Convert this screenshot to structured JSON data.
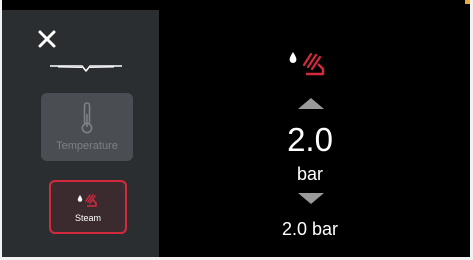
{
  "sidebar": {
    "close_icon": "close-icon",
    "modes": [
      {
        "label": "Temperature",
        "icon": "thermometer-icon",
        "state": "disabled"
      },
      {
        "label": "Steam",
        "icon": "steam-icon",
        "state": "selected"
      }
    ]
  },
  "main": {
    "mode_icon": "steam-icon",
    "value": "2.0",
    "unit": "bar",
    "current_value": "2.0 bar"
  },
  "colors": {
    "sidebar_bg": "#2b2e31",
    "main_bg": "#000000",
    "accent_red": "#d42a3d",
    "disabled_btn": "#4a4d51",
    "arrow_gray": "#9a9a9a"
  }
}
